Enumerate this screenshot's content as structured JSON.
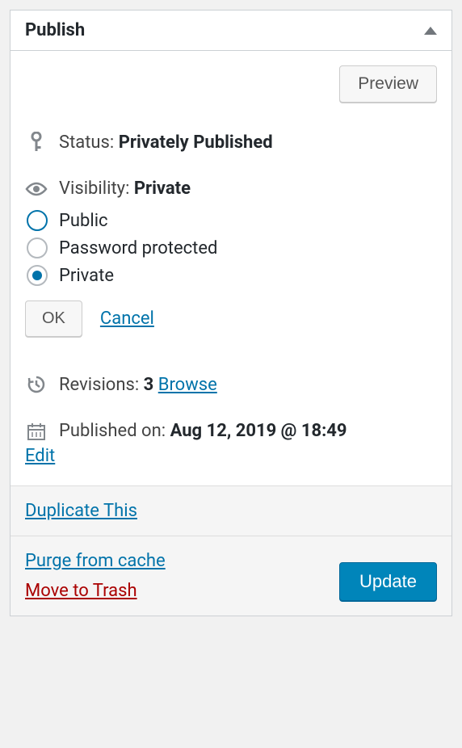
{
  "header": {
    "title": "Publish"
  },
  "preview": {
    "label": "Preview"
  },
  "status": {
    "label": "Status:",
    "value": "Privately Published"
  },
  "visibility": {
    "label": "Visibility:",
    "value": "Private",
    "options": {
      "public": "Public",
      "password": "Password protected",
      "private": "Private"
    },
    "ok": "OK",
    "cancel": "Cancel"
  },
  "revisions": {
    "label": "Revisions:",
    "count": "3",
    "browse": "Browse"
  },
  "published": {
    "label": "Published on:",
    "date": "Aug 12, 2019 @ 18:49",
    "edit": "Edit"
  },
  "footer": {
    "duplicate": "Duplicate This",
    "purge": "Purge from cache",
    "trash": "Move to Trash",
    "update": "Update"
  }
}
